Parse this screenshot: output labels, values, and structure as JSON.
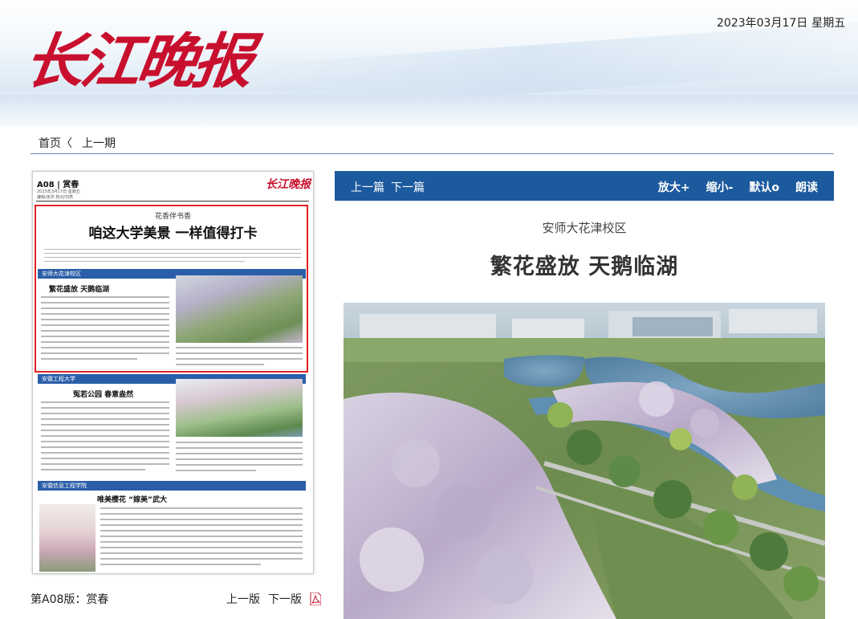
{
  "masthead": {
    "logo_text": "长江晚报",
    "date": "2023年03月17日",
    "weekday": "星期五"
  },
  "nav": {
    "home": "首页",
    "prev_issue": "上一期"
  },
  "page_thumbnail": {
    "page_label": "A08",
    "page_section": "赏春",
    "thumb_logo": "长江晚报",
    "date_line": "2023年3月17日 星期五",
    "editor_line": "编辑/张洪 校对/刘亮",
    "kicker": "花香伴书香",
    "headline": "咱这大学美景 一样值得打卡",
    "section1": "安师大花津校区",
    "article1_title": "繁花盛放 天鹅临湖",
    "section2": "安徽工程大学",
    "article2_title": "冤若公园 春意盎然",
    "section3": "安徽信息工程学院",
    "article3_title": "唯美樱花 “嫁美”武大"
  },
  "footer": {
    "page_name": "第A08版：赏春",
    "prev_page": "上一版",
    "next_page": "下一版"
  },
  "toolbar": {
    "prev_article": "上一篇",
    "next_article": "下一篇",
    "zoom_in": "放大+",
    "zoom_out": "缩小-",
    "default": "默认o",
    "read_aloud": "朗读"
  },
  "article": {
    "subheading": "安师大花津校区",
    "title": "繁花盛放 天鹅临湖"
  },
  "colors": {
    "toolbar_bg": "#1c5a9e",
    "highlight_border": "#e32222",
    "logo_red": "#c8102e",
    "section_bar": "#2a5ea8"
  },
  "icons": [
    "pdf-icon",
    "photo-image"
  ]
}
